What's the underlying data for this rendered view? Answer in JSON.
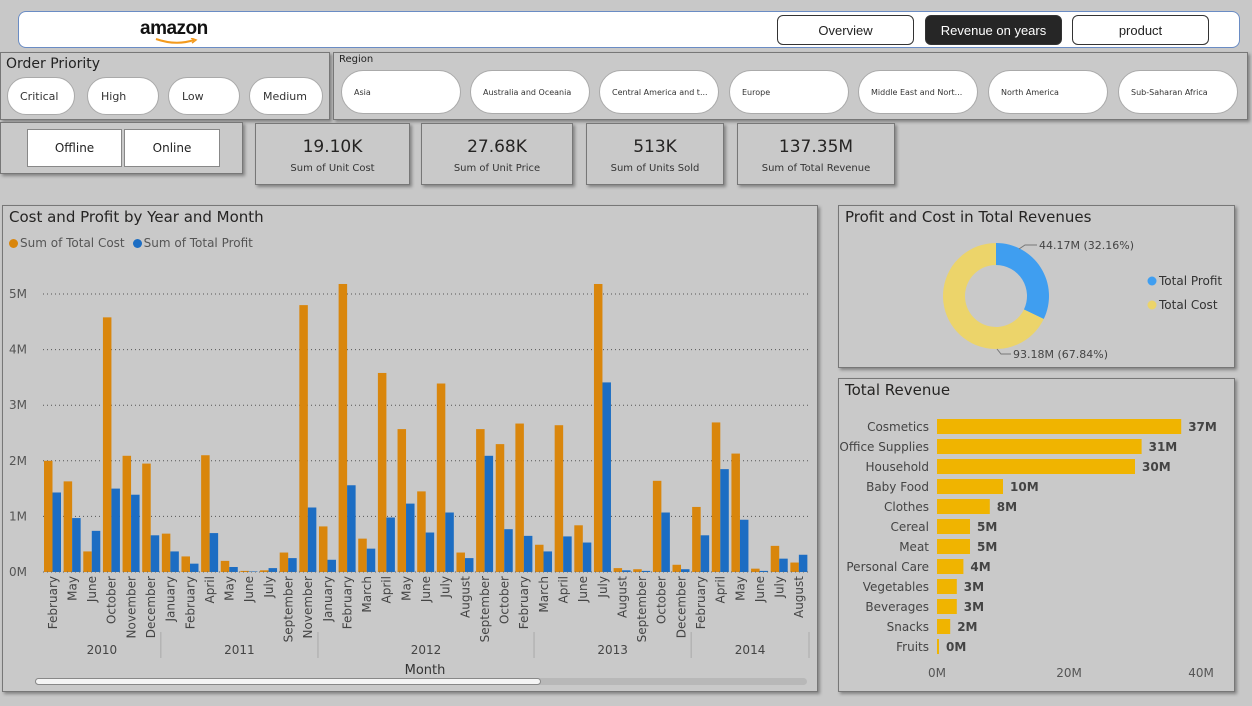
{
  "nav": {
    "logo": "amazon",
    "buttons": [
      "Overview",
      "Revenue on years",
      "product"
    ],
    "active_index": 1
  },
  "order_priority": {
    "title": "Order Priority",
    "options": [
      "Critical",
      "High",
      "Low",
      "Medium"
    ]
  },
  "region": {
    "title": "Region",
    "options": [
      "Asia",
      "Australia and Oceania",
      "Central America and t...",
      "Europe",
      "Middle East and Nort...",
      "North America",
      "Sub-Saharan Africa"
    ]
  },
  "channel": {
    "options": [
      "Offline",
      "Online"
    ]
  },
  "kpis": [
    {
      "value": "19.10K",
      "label": "Sum of Unit Cost"
    },
    {
      "value": "27.68K",
      "label": "Sum of Unit Price"
    },
    {
      "value": "513K",
      "label": "Sum of Units Sold"
    },
    {
      "value": "137.35M",
      "label": "Sum of Total Revenue"
    }
  ],
  "colors": {
    "cost": "#d9860c",
    "profit": "#1c6dc3",
    "donut_profit": "#3f9ef0",
    "donut_cost": "#ecd46a",
    "bar": "#f0b400"
  },
  "chart_data": [
    {
      "type": "bar",
      "title": "Cost and Profit by Year and Month",
      "xlabel": "Month",
      "ylabel": "",
      "ylim": [
        0,
        5.3
      ],
      "yticks": [
        "0M",
        "1M",
        "2M",
        "3M",
        "4M",
        "5M"
      ],
      "legend": "top-left",
      "grid": true,
      "categories": [
        "February",
        "May",
        "June",
        "October",
        "November",
        "December",
        "January",
        "February",
        "April",
        "May",
        "June",
        "July",
        "September",
        "November",
        "January",
        "February",
        "March",
        "April",
        "May",
        "June",
        "July",
        "August",
        "September",
        "October",
        "February",
        "March",
        "April",
        "June",
        "July",
        "August",
        "September",
        "October",
        "December",
        "February",
        "April",
        "May",
        "June",
        "July",
        "August"
      ],
      "years": [
        {
          "label": "2010",
          "start": 0,
          "end": 5
        },
        {
          "label": "2011",
          "start": 6,
          "end": 13
        },
        {
          "label": "2012",
          "start": 14,
          "end": 24
        },
        {
          "label": "2013",
          "start": 25,
          "end": 32
        },
        {
          "label": "2014",
          "start": 33,
          "end": 38
        }
      ],
      "series": [
        {
          "name": "Sum of Total Cost",
          "values": [
            2.0,
            1.63,
            0.37,
            4.58,
            2.09,
            1.95,
            0.69,
            0.28,
            2.1,
            0.2,
            0.02,
            0.03,
            0.35,
            4.8,
            0.82,
            5.18,
            0.6,
            3.58,
            2.57,
            1.45,
            3.39,
            0.35,
            2.57,
            2.3,
            2.67,
            0.49,
            2.64,
            0.84,
            5.18,
            0.07,
            0.05,
            1.64,
            0.13,
            1.17,
            2.69,
            2.13,
            0.06,
            0.47,
            0.17
          ]
        },
        {
          "name": "Sum of Total Profit",
          "values": [
            1.43,
            0.97,
            0.74,
            1.5,
            1.39,
            0.66,
            0.37,
            0.15,
            0.7,
            0.09,
            0.01,
            0.07,
            0.25,
            1.16,
            0.22,
            1.56,
            0.42,
            0.98,
            1.23,
            0.71,
            1.07,
            0.25,
            2.09,
            0.77,
            0.65,
            0.37,
            0.64,
            0.53,
            3.41,
            0.03,
            0.02,
            1.07,
            0.05,
            0.66,
            1.85,
            0.94,
            0.02,
            0.24,
            0.31
          ]
        }
      ]
    },
    {
      "type": "pie",
      "title": "Profit and Cost in Total Revenues",
      "legend": "right",
      "categories": [
        "Total Profit",
        "Total Cost"
      ],
      "values": [
        44.17,
        93.18
      ],
      "data_labels": [
        "44.17M (32.16%)",
        "93.18M (67.84%)"
      ]
    },
    {
      "type": "bar",
      "title": "Total Revenue",
      "orientation": "horizontal",
      "xlim": [
        0,
        40
      ],
      "xticks": [
        "0M",
        "20M",
        "40M"
      ],
      "categories": [
        "Cosmetics",
        "Office Supplies",
        "Household",
        "Baby Food",
        "Clothes",
        "Cereal",
        "Meat",
        "Personal Care",
        "Vegetables",
        "Beverages",
        "Snacks",
        "Fruits"
      ],
      "values": [
        37,
        31,
        30,
        10,
        8,
        5,
        5,
        4,
        3,
        3,
        2,
        0.3
      ],
      "data_labels": [
        "37M",
        "31M",
        "30M",
        "10M",
        "8M",
        "5M",
        "5M",
        "4M",
        "3M",
        "3M",
        "2M",
        "0M"
      ]
    }
  ]
}
